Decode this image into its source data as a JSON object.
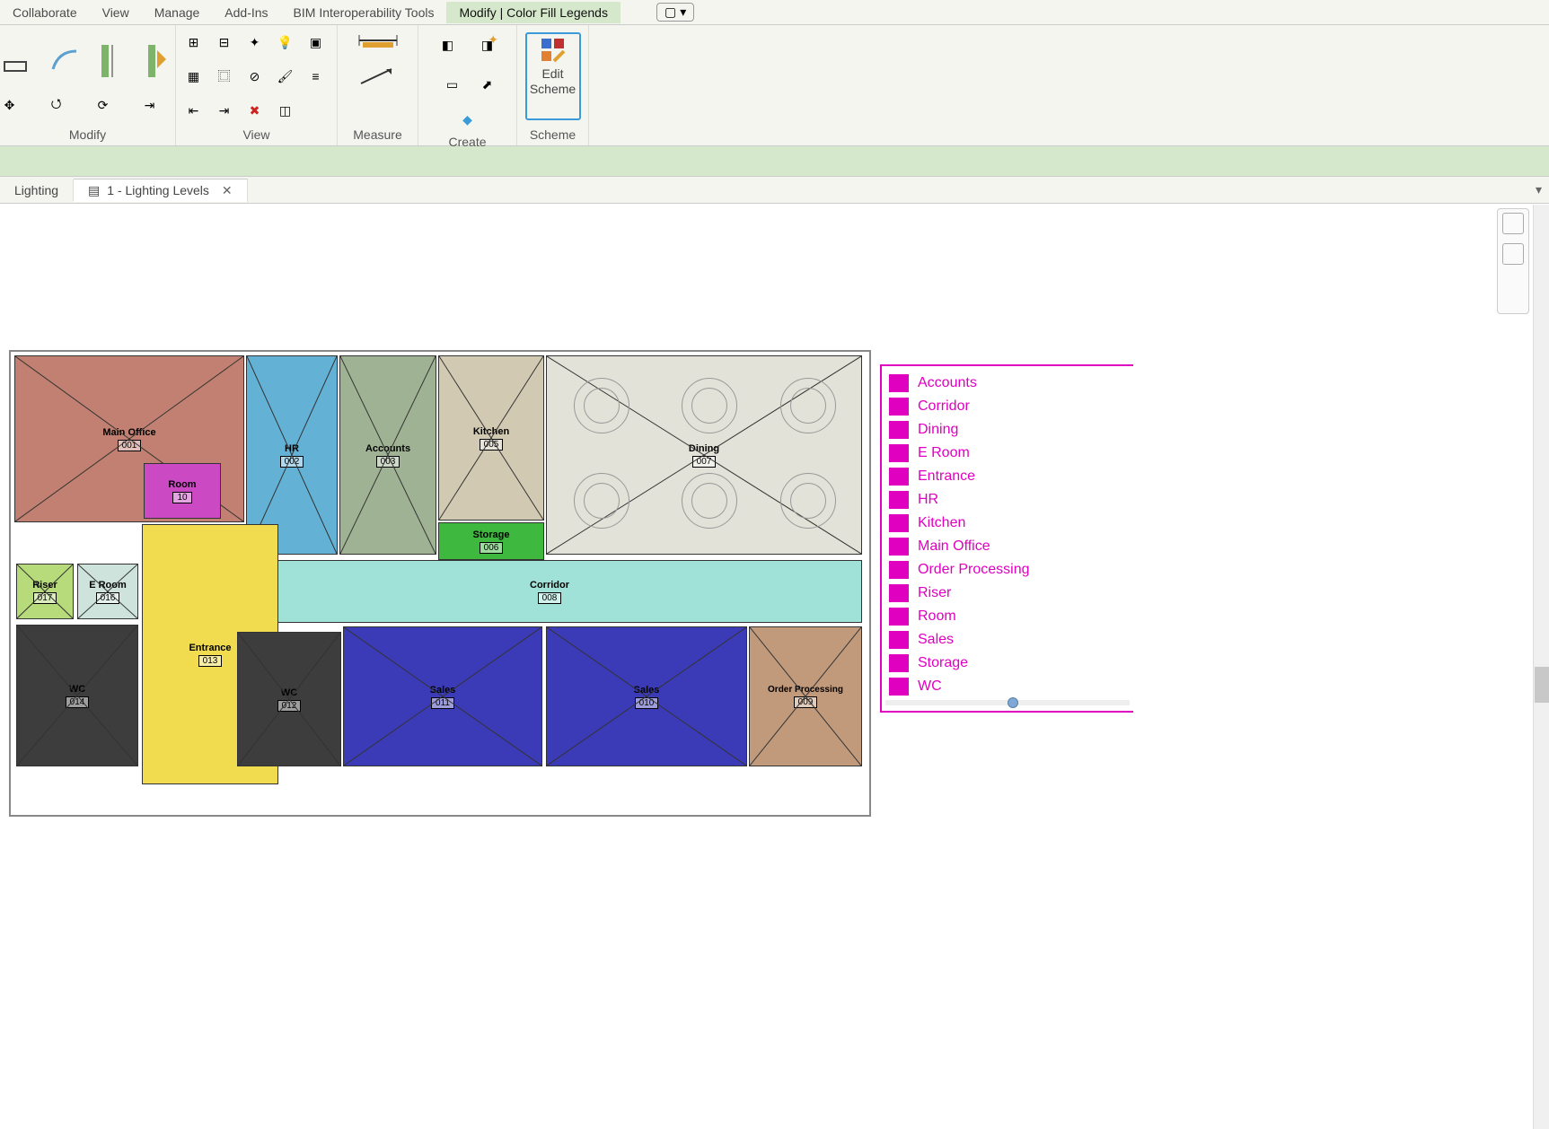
{
  "ribbon_tabs": {
    "collaborate": "Collaborate",
    "view": "View",
    "manage": "Manage",
    "addins": "Add-Ins",
    "bim": "BIM Interoperability Tools",
    "modify": "Modify | Color Fill Legends"
  },
  "ribbon_panels": {
    "modify": "Modify",
    "view": "View",
    "measure": "Measure",
    "create": "Create",
    "scheme": "Scheme"
  },
  "edit_scheme": {
    "line1": "Edit",
    "line2": "Scheme"
  },
  "view_tabs": {
    "lighting": "Lighting",
    "lighting_levels": "1 - Lighting Levels"
  },
  "rooms": {
    "main_office": {
      "name": "Main Office",
      "num": "001",
      "color": "#c18071"
    },
    "hr": {
      "name": "HR",
      "num": "002",
      "color": "#63b2d6"
    },
    "accounts": {
      "name": "Accounts",
      "num": "003",
      "color": "#9fb394"
    },
    "kitchen": {
      "name": "Kitchen",
      "num": "005",
      "color": "#d2c9b2"
    },
    "dining": {
      "name": "Dining",
      "num": "007",
      "color": "#e2e2d8"
    },
    "room": {
      "name": "Room",
      "num": "10",
      "color": "#cb4ac4"
    },
    "storage": {
      "name": "Storage",
      "num": "006",
      "color": "#3eb83e"
    },
    "corridor": {
      "name": "Corridor",
      "num": "008",
      "color": "#a1e2d8"
    },
    "riser": {
      "name": "Riser",
      "num": "017",
      "color": "#b7db7a"
    },
    "eroom": {
      "name": "E Room",
      "num": "016",
      "color": "#cde3db"
    },
    "entrance": {
      "name": "Entrance",
      "num": "013",
      "color": "#f1dc4f"
    },
    "wc1": {
      "name": "WC",
      "num": "014",
      "color": "#3d3d3d"
    },
    "wc2": {
      "name": "WC",
      "num": "012",
      "color": "#3d3d3d"
    },
    "sales1": {
      "name": "Sales",
      "num": "011",
      "color": "#3b3bb8"
    },
    "sales2": {
      "name": "Sales",
      "num": "010",
      "color": "#3b3bb8"
    },
    "orderproc": {
      "name": "Order Processing",
      "num": "009",
      "color": "#c1997b"
    }
  },
  "legend": [
    "Accounts",
    "Corridor",
    "Dining",
    "E Room",
    "Entrance",
    "HR",
    "Kitchen",
    "Main Office",
    "Order Processing",
    "Riser",
    "Room",
    "Sales",
    "Storage",
    "WC"
  ]
}
